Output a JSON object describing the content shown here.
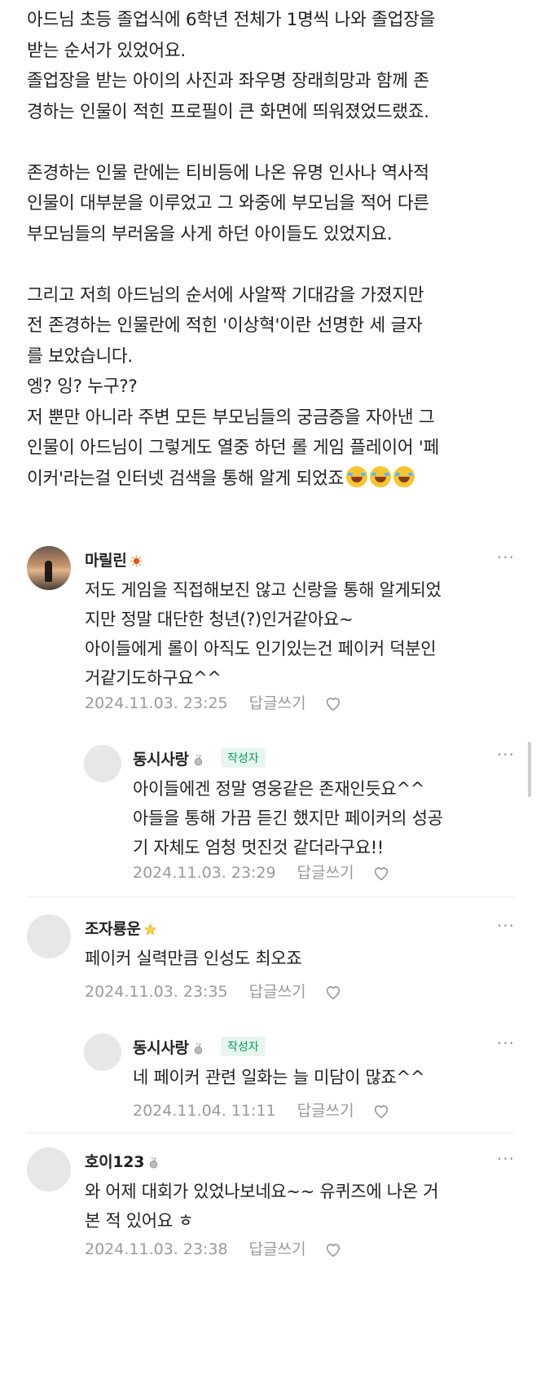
{
  "post": {
    "paragraphs": [
      "아드님 초등 졸업식에 6학년 전체가 1명씩 나와 졸업장을\n받는 순서가 있었어요.\n졸업장을 받는 아이의 사진과 좌우명 장래희망과 함께 존\n경하는 인물이 적힌 프로필이 큰 화면에 띄워졌었드랬죠.",
      "존경하는 인물 란에는 티비등에 나온 유명 인사나 역사적\n인물이 대부분을 이루었고 그 와중에 부모님을 적어 다른\n부모님들의 부러움을 사게 하던 아이들도 있었지요.",
      "그리고 저희 아드님의 순서에 사알짝 기대감을 가졌지만\n전 존경하는 인물란에 적힌 '이상혁'이란 선명한 세 글자\n를 보았습니다.\n엥? 잉? 누구??\n저 뿐만 아니라 주변 모든 부모님들의 궁금증을 자아낸 그\n인물이 아드님이 그렇게도 열중 하던 롤 게임 플레이어 '페\n이커'라는걸 인터넷 검색을 통해 알게 되었죠"
    ],
    "emojis": [
      "face-with-tears-of-joy",
      "face-with-tears-of-joy",
      "face-with-tears-of-joy"
    ]
  },
  "comments": [
    {
      "nickname": "마릴린",
      "badge": "sun-badge-icon",
      "text": "저도 게임을 직접해보진 않고 신랑을 통해 알게되었\n지만 정말 대단한 청년(?)인거같아요~\n아이들에게 롤이 아직도 인기있는건 페이커 덕분인\n거같기도하구요^^",
      "date": "2024.11.03. 23:25",
      "reply_label": "답글쓰기"
    },
    {
      "nickname": "동시사랑",
      "badge": "medal-badge-icon",
      "writer_label": "작성자",
      "text": "아이들에겐 정말 영웅같은 존재인듯요^^\n아들을 통해 가끔 듣긴 했지만 페이커의 성공\n기 자체도 엄청 멋진것 같더라구요!!",
      "date": "2024.11.03. 23:29",
      "reply_label": "답글쓰기"
    },
    {
      "nickname": "조자룡운",
      "badge": "star-badge-icon",
      "text": "페이커 실력만큼 인성도 최오죠",
      "date": "2024.11.03. 23:35",
      "reply_label": "답글쓰기"
    },
    {
      "nickname": "동시사랑",
      "badge": "medal-badge-icon",
      "writer_label": "작성자",
      "text": "네 페이커 관련 일화는 늘 미담이 많죠^^",
      "date": "2024.11.04. 11:11",
      "reply_label": "답글쓰기"
    },
    {
      "nickname": "호이123",
      "badge": "medal-badge-icon",
      "text": "와 어제 대회가 있었나보네요~~ 유퀴즈에 나온 거\n본 적 있어요 ㅎ",
      "date": "2024.11.03. 23:38",
      "reply_label": "답글쓰기"
    }
  ],
  "more_glyph": "···",
  "colors": {
    "writer_badge": "#0b9c5e",
    "meta": "#9a9a9a"
  }
}
